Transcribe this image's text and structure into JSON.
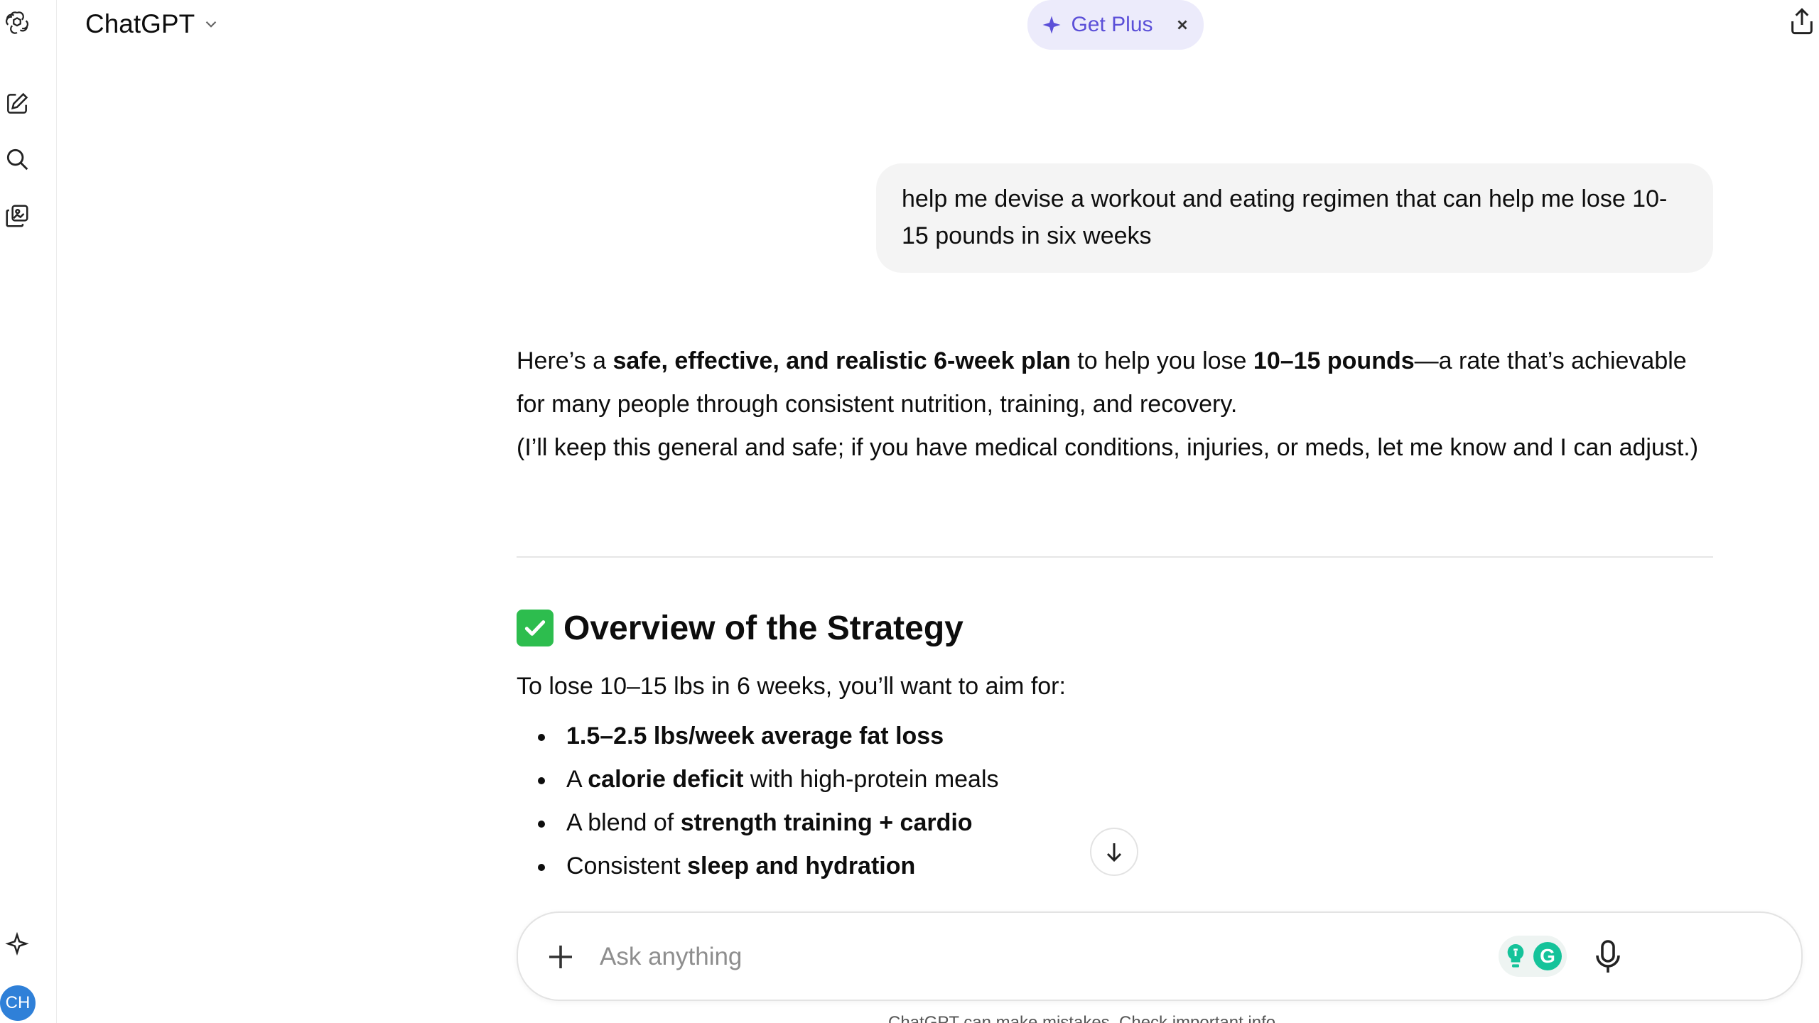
{
  "header": {
    "model_label": "ChatGPT",
    "get_plus_label": "Get Plus"
  },
  "sidebar": {
    "items": [
      {
        "name": "new-chat",
        "icon": "compose-icon"
      },
      {
        "name": "search",
        "icon": "search-icon"
      },
      {
        "name": "library",
        "icon": "library-icon"
      }
    ],
    "bottom_icon": "sparkle-icon",
    "avatar_initials": "CH"
  },
  "conversation": {
    "user_message": "help me devise a workout and eating regimen that can help me lose 10-15 pounds in six weeks",
    "assistant": {
      "p1_a": "Here’s a ",
      "p1_b": "safe, effective, and realistic 6-week plan",
      "p1_c": " to help you lose ",
      "p1_d": "10–15 pounds",
      "p1_e": "—a rate that’s achievable for many people through consistent nutrition, training, and recovery.",
      "p2": "(I’ll keep this general and safe; if you have medical conditions, injuries, or meds, let me know and I can adjust.)",
      "overview_title": "Overview of the Strategy",
      "overview_intro": "To lose 10–15 lbs in 6 weeks, you’ll want to aim for:",
      "bullets": [
        {
          "pre": "",
          "bold": "1.5–2.5 lbs/week average fat loss",
          "post": ""
        },
        {
          "pre": "A ",
          "bold": "calorie deficit",
          "post": " with high-protein meals"
        },
        {
          "pre": "A blend of ",
          "bold": "strength training + cardio",
          "post": ""
        },
        {
          "pre": "Consistent ",
          "bold": "sleep and hydration",
          "post": ""
        }
      ]
    }
  },
  "composer": {
    "placeholder": "Ask anything",
    "extension_letter": "G"
  },
  "footer": {
    "note": "ChatGPT can make mistakes. Check important info."
  },
  "colors": {
    "accent": "#5b4fd8",
    "get_plus_bg": "#ecebfb",
    "check_green": "#2dbd4e",
    "grammarly": "#15c39a",
    "avatar": "#2f80d8"
  }
}
